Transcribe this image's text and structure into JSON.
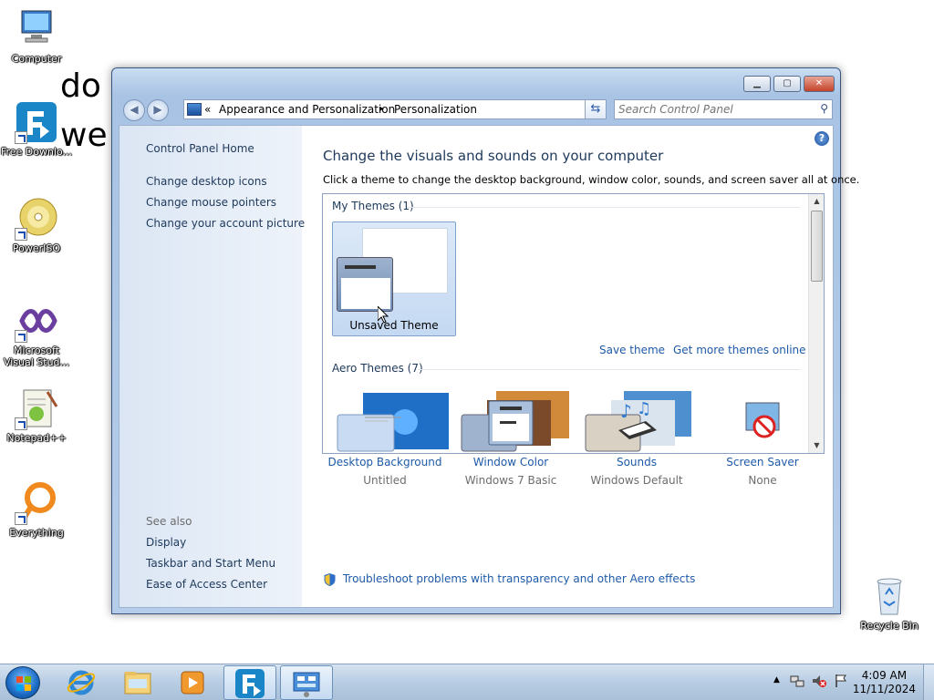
{
  "desktop": {
    "icons": [
      {
        "label": "Computer"
      },
      {
        "label": "Free Downlo..."
      },
      {
        "label": "PowerISO"
      },
      {
        "label": "Microsoft Visual Stud..."
      },
      {
        "label": "Notepad++"
      },
      {
        "label": "Everything"
      },
      {
        "label": "Recycle Bin"
      }
    ],
    "bg_text_line1": "do",
    "bg_text_line2": "we"
  },
  "window": {
    "address": {
      "chevron": "«",
      "crumb1": "Appearance and Personalization",
      "separator": "▸",
      "crumb2": "Personalization"
    },
    "search": {
      "placeholder": "Search Control Panel"
    },
    "left_pane": {
      "home": "Control Panel Home",
      "links": [
        "Change desktop icons",
        "Change mouse pointers",
        "Change your account picture"
      ],
      "see_also_label": "See also",
      "see_also": [
        "Display",
        "Taskbar and Start Menu",
        "Ease of Access Center"
      ]
    },
    "main": {
      "title": "Change the visuals and sounds on your computer",
      "subtitle": "Click a theme to change the desktop background, window color, sounds, and screen saver all at once.",
      "my_themes_label": "My Themes (1)",
      "unsaved_theme": "Unsaved Theme",
      "save_theme": "Save theme",
      "get_more": "Get more themes online",
      "aero_themes_label": "Aero Themes (7)",
      "bottom": [
        {
          "label": "Desktop Background",
          "value": "Untitled"
        },
        {
          "label": "Window Color",
          "value": "Windows 7 Basic"
        },
        {
          "label": "Sounds",
          "value": "Windows Default"
        },
        {
          "label": "Screen Saver",
          "value": "None"
        }
      ],
      "troubleshoot": "Troubleshoot problems with transparency and other Aero effects"
    }
  },
  "taskbar": {
    "time": "4:09 AM",
    "date": "11/11/2024"
  },
  "colors": {
    "link": "#1e5aa8",
    "title": "#1e395b",
    "taskbar": "#b8cde3"
  }
}
